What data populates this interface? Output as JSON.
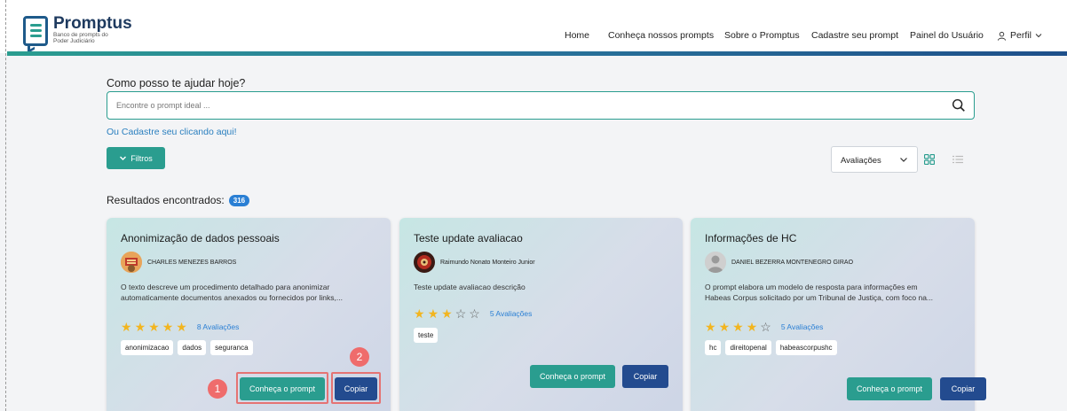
{
  "brand": {
    "name": "Promptus",
    "subtitle_line1": "Banco de prompts do",
    "subtitle_line2": "Poder Judiciário"
  },
  "nav": {
    "items": [
      "Home",
      "Conheça nossos prompts",
      "Sobre o Promptus",
      "Cadastre seu prompt",
      "Painel do Usuário"
    ],
    "profile_label": "Perfil"
  },
  "search": {
    "question": "Como posso te ajudar hoje?",
    "placeholder": "Encontre o prompt ideal ...",
    "register_link": "Ou Cadastre seu clicando aqui!"
  },
  "toolbar": {
    "filters_label": "Filtros",
    "sort_value": "Avaliações"
  },
  "results": {
    "label": "Resultados encontrados:",
    "count": "316"
  },
  "colors": {
    "accent": "#2a9d8f",
    "secondary": "#234b8f",
    "star": "#f2b51f",
    "callout": "#e57373"
  },
  "cards": [
    {
      "title": "Anonimização de dados pessoais",
      "author": "CHARLES MENEZES BARROS",
      "description_line1": "O texto descreve um procedimento detalhado para anonimizar",
      "description_line2": "automaticamente documentos anexados ou fornecidos por links,...",
      "rating": 5,
      "rating_label": "8 Avaliações",
      "tags": [
        "anonimizacao",
        "dados",
        "seguranca"
      ],
      "primary_label": "Conheça o prompt",
      "secondary_label": "Copiar"
    },
    {
      "title": "Teste update avaliacao",
      "author": "Raimundo Nonato Monteiro Junior",
      "description_line1": "Teste update avaliacao descrição",
      "description_line2": "",
      "rating": 3,
      "rating_label": "5 Avaliações",
      "tags": [
        "teste"
      ],
      "primary_label": "Conheça o prompt",
      "secondary_label": "Copiar"
    },
    {
      "title": "Informações de HC",
      "author": "DANIEL BEZERRA MONTENEGRO GIRAO",
      "description_line1": "O prompt elabora um modelo de resposta para informações em",
      "description_line2": "Habeas Corpus solicitado por um Tribunal de Justiça, com foco na...",
      "rating": 4,
      "rating_label": "5 Avaliações",
      "tags": [
        "hc",
        "direitopenal",
        "habeascorpushc"
      ],
      "primary_label": "Conheça o prompt",
      "secondary_label": "Copiar"
    }
  ],
  "annotations": {
    "marker1": "1",
    "marker2": "2"
  }
}
